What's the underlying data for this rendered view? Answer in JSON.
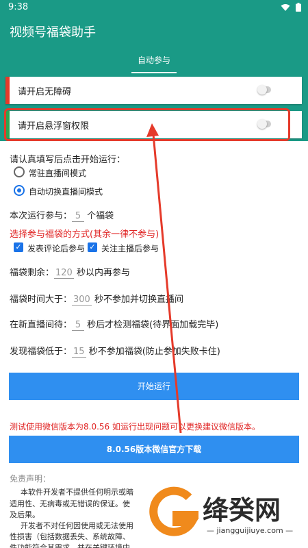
{
  "status_bar": {
    "time": "9:38"
  },
  "app": {
    "title": "视频号福袋助手"
  },
  "tab": {
    "label": "自动参与"
  },
  "permissions": [
    {
      "label": "请开启无障碍",
      "bar_color": "#e53a2a",
      "enabled": false
    },
    {
      "label": "请开启悬浮窗权限",
      "bar_color": "#2ea44f",
      "enabled": false
    }
  ],
  "form": {
    "instruction": "请认真填写后点击开始运行：",
    "mode_options": [
      {
        "label": "常驻直播间模式",
        "selected": false
      },
      {
        "label": "自动切换直播间模式",
        "selected": true
      }
    ],
    "run_count": {
      "prefix": "本次运行参与：",
      "value": "5",
      "suffix": "个福袋"
    },
    "method_title": "选择参与福袋的方式(其余一律不参与)",
    "methods": [
      {
        "label": "发表评论后参与",
        "checked": true
      },
      {
        "label": "关注主播后参与",
        "checked": true
      }
    ],
    "remaining": {
      "prefix": "福袋剩余：",
      "value": "120",
      "suffix": "秒以内再参与"
    },
    "time_gt": {
      "prefix": "福袋时间大于：",
      "value": "300",
      "suffix": "秒不参加并切换直播间"
    },
    "wait": {
      "prefix": "在新直播间待：",
      "value": "5",
      "suffix": "秒后才检测福袋(待界面加载完毕)"
    },
    "below": {
      "prefix": "发现福袋低于：",
      "value": "15",
      "suffix": "秒不参加福袋(防止参加失败卡住)"
    }
  },
  "buttons": {
    "start": "开始运行",
    "download": "8.0.56版本微信官方下载"
  },
  "notice": "测试使用微信版本为8.0.56 如运行出现问题可以更换建议微信版本。",
  "disclaimer": {
    "title": "免责声明：",
    "lines": [
      "本软件开发者不提供任何明示或暗",
      "适用性、无病毒或无错误的保证。使",
      "及后果。",
      "开发者不对任何因使用或无法使用",
      "性损害（包括数据丢失、系统故障、",
      "件功能符合其需求，并在关键环境中"
    ]
  },
  "watermark": {
    "title": "绛癸网",
    "subtitle": "— jiangguijiuye.com —"
  },
  "colors": {
    "primary": "#1a9a86",
    "button": "#2f8ff0",
    "accent_red": "#e53a2a"
  }
}
